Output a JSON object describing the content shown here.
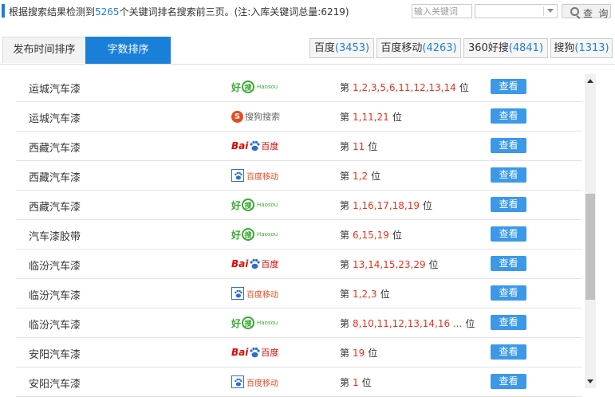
{
  "header": {
    "summary_prefix": "根据搜索结果检测到",
    "keyword_count": "5265",
    "summary_suffix": "个关键词排名搜索前三页。(注:入库关键词总量:6219)",
    "search_placeholder": "输入关键词",
    "select_value": "",
    "query_label": "查 询"
  },
  "sort_tabs": [
    {
      "label": "发布时间排序",
      "active": false
    },
    {
      "label": "字数排序",
      "active": true
    }
  ],
  "engine_tabs": [
    {
      "label": "百度",
      "count": "(3453)"
    },
    {
      "label": "百度移动",
      "count": "(4263)"
    },
    {
      "label": "360好搜",
      "count": "(4841)"
    },
    {
      "label": "搜狗",
      "count": "(1313)"
    }
  ],
  "rank_prefix": "第",
  "rank_suffix": "位",
  "view_label": "查看",
  "rows": [
    {
      "keyword": "运城汽车漆",
      "engine": "haosou",
      "positions": "1,2,3,5,6,11,12,13,14"
    },
    {
      "keyword": "运城汽车漆",
      "engine": "sogou",
      "positions": "1,11,21"
    },
    {
      "keyword": "西藏汽车漆",
      "engine": "baidu",
      "positions": "11"
    },
    {
      "keyword": "西藏汽车漆",
      "engine": "baidu_mobile",
      "positions": "1,2"
    },
    {
      "keyword": "西藏汽车漆",
      "engine": "haosou",
      "positions": "1,16,17,18,19"
    },
    {
      "keyword": "汽车漆胶带",
      "engine": "haosou",
      "positions": "6,15,19"
    },
    {
      "keyword": "临汾汽车漆",
      "engine": "baidu",
      "positions": "13,14,15,23,29"
    },
    {
      "keyword": "临汾汽车漆",
      "engine": "baidu_mobile",
      "positions": "1,2,3"
    },
    {
      "keyword": "临汾汽车漆",
      "engine": "haosou",
      "positions": "8,10,11,12,13,14,16 ..."
    },
    {
      "keyword": "安阳汽车漆",
      "engine": "baidu",
      "positions": "19"
    },
    {
      "keyword": "安阳汽车漆",
      "engine": "baidu_mobile",
      "positions": "1"
    }
  ],
  "logos": {
    "haosou": {
      "cn": "好",
      "circle": "搜",
      "en": "Haosou"
    },
    "sogou": {
      "s": "S",
      "text": "搜狗搜索"
    },
    "baidu": {
      "bai": "Bai",
      "cn": "百度"
    },
    "baidu_mobile": {
      "text": "百度移动"
    }
  },
  "colors": {
    "accent": "#1a7fd8",
    "rank": "#e8331c",
    "button": "#3b99e8"
  }
}
